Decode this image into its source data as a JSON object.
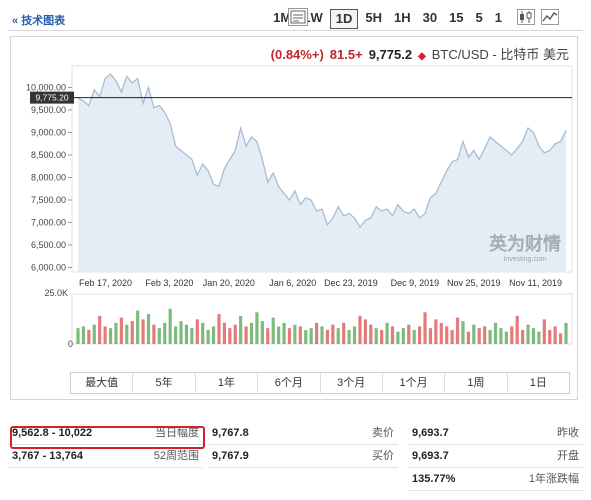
{
  "toolbar": {
    "periods": [
      "1",
      "5",
      "15",
      "30",
      "1H",
      "5H",
      "1D",
      "1W",
      "1M"
    ],
    "active_period": "1D",
    "technical_link": "技术图表 »"
  },
  "quote": {
    "pair": "BTC/USD - 比特币 美元",
    "last": "9,775.2",
    "change": "+81.5",
    "change_pct": "(+0.84%)"
  },
  "watermark": {
    "brand": "英为财情",
    "sub": "Investing.com"
  },
  "ranges": [
    "1日",
    "1周",
    "1个月",
    "3个月",
    "6个月",
    "1年",
    "5年",
    "最大值"
  ],
  "chart_data": {
    "type": "area",
    "x_tick_labels": [
      "Nov 11, 2019",
      "Nov 25, 2019",
      "Dec 9, 2019",
      "Dec 23, 2019",
      "Jan 6, 2020",
      "Jan 20, 2020",
      "Feb 3, 2020",
      "Feb 17, 2020"
    ],
    "y_tick_labels": [
      "10,000.00",
      "9,500.00",
      "9,000.00",
      "8,500.00",
      "8,000.00",
      "7,500.00",
      "7,000.00",
      "6,500.00",
      "6,000.00"
    ],
    "ylim": [
      5900,
      10300
    ],
    "last_price_label": "9,775.20",
    "last_price": 9775.2,
    "volume_label": "25.0K",
    "volume_zero_label": "0",
    "price_series_oldest_to_newest": [
      9050,
      8800,
      8750,
      8600,
      8550,
      8700,
      9000,
      9100,
      8800,
      8650,
      8500,
      8600,
      8700,
      8800,
      8900,
      8650,
      8400,
      8600,
      8450,
      8800,
      8400,
      8350,
      8150,
      7900,
      7650,
      7550,
      7200,
      7100,
      7300,
      7200,
      7250,
      7400,
      7150,
      7300,
      7250,
      7350,
      7100,
      7050,
      6900,
      7100,
      7200,
      7150,
      7350,
      7100,
      6950,
      7300,
      7250,
      7500,
      7550,
      7400,
      7700,
      7500,
      7650,
      7800,
      8100,
      7900,
      8400,
      8800,
      8900,
      8700,
      9100,
      8600,
      8400,
      8200,
      7800,
      7850,
      8150,
      8300,
      8050,
      8400,
      8500,
      8600,
      8700,
      9200,
      9450,
      9600,
      9550,
      10000,
      9650,
      10200,
      10100,
      10250,
      9900,
      10150,
      10300,
      10200,
      9800,
      9950,
      9600,
      9700,
      9775
    ],
    "volume_series_oldest_to_newest": [
      12,
      6,
      10,
      8,
      14,
      7,
      9,
      11,
      8,
      16,
      10,
      7,
      9,
      12,
      8,
      10,
      9,
      11,
      7,
      13,
      15,
      8,
      10,
      12,
      14,
      9,
      18,
      10,
      8,
      11,
      9,
      7,
      10,
      12,
      8,
      9,
      11,
      14,
      16,
      10,
      8,
      12,
      9,
      11,
      8,
      10,
      12,
      9,
      8,
      10,
      11,
      9,
      12,
      10,
      15,
      9,
      13,
      18,
      12,
      10,
      16,
      11,
      9,
      12,
      17,
      10,
      8,
      12,
      14,
      9,
      11,
      13,
      10,
      20,
      12,
      9,
      11,
      17,
      14,
      19,
      13,
      11,
      15,
      12,
      9,
      10,
      16,
      11,
      8,
      10,
      9
    ]
  },
  "stats": {
    "rows": [
      {
        "label": "昨收",
        "value": "9,693.7"
      },
      {
        "label": "开盘",
        "value": "9,693.7"
      },
      {
        "label": "1年涨跌幅",
        "value": "135.77%"
      },
      {
        "label": "卖价",
        "value": "9,767.8"
      },
      {
        "label": "买价",
        "value": "9,767.9"
      },
      {
        "label": "当日幅度",
        "value": "9,562.8 - 10,022"
      },
      {
        "label": "52周范围",
        "value": "3,767 - 13,764"
      }
    ]
  },
  "colors": {
    "price_line": "#a7bdd6",
    "price_fill": "#e4ecf5",
    "vol_up": "#7dbb7d",
    "vol_down": "#e57a7a",
    "highlight": "#d61f26",
    "change_up": "#c0272d"
  }
}
